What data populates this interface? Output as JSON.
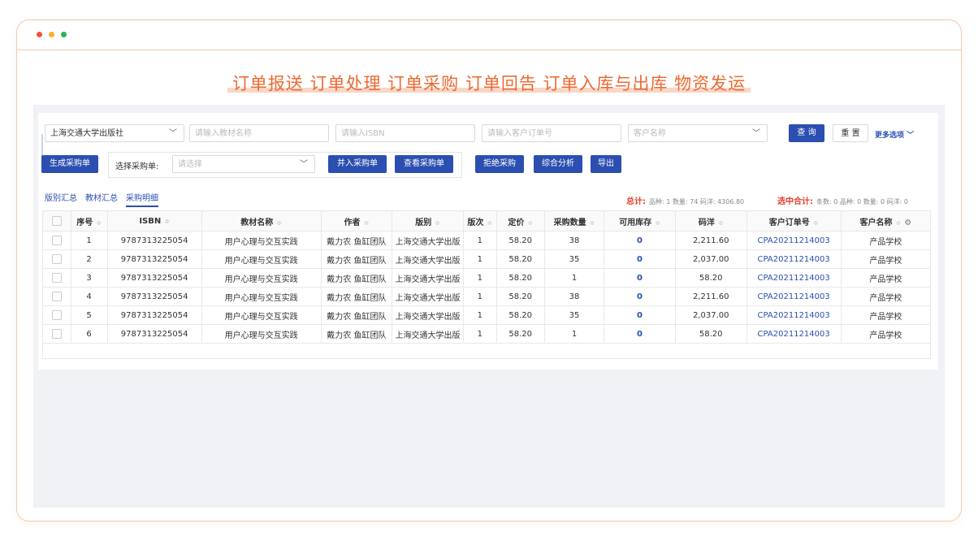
{
  "headline": "订单报送 订单处理 订单采购 订单回告 订单入库与出库 物资发运",
  "filters": {
    "publisher_value": "上海交通大学出版社",
    "textbook_placeholder": "请输入教材名称",
    "isbn_placeholder": "请输入ISBN",
    "order_no_placeholder": "请输入客户订单号",
    "customer_placeholder": "客户名称",
    "query_label": "查 询",
    "reset_label": "重 置",
    "more_label": "更多选项"
  },
  "actions": {
    "generate_label": "生成采购单",
    "select_label": "选择采购单:",
    "select_placeholder": "请选择",
    "merge_label": "并入采购单",
    "view_label": "查看采购单",
    "reject_label": "拒绝采购",
    "analysis_label": "综合分析",
    "export_label": "导出"
  },
  "tabs": [
    "版别汇总",
    "教材汇总",
    "采购明细"
  ],
  "summary": {
    "total_label": "总计:",
    "total_text": "品种: 1   数量: 74   码洋: 4306.80",
    "selected_label": "选中合计:",
    "selected_text": "条数: 0   品种: 0   数量: 0   码洋: 0"
  },
  "table": {
    "headers": [
      "序号",
      "ISBN",
      "教材名称",
      "作者",
      "版别",
      "版次",
      "定价",
      "采购数量",
      "可用库存",
      "码洋",
      "客户订单号",
      "客户名称"
    ],
    "rows": [
      [
        "1",
        "9787313225054",
        "用户心理与交互实践",
        "戴力农 鱼缸团队",
        "上海交通大学出版",
        "1",
        "58.20",
        "38",
        "0",
        "2,211.60",
        "CPA20211214003",
        "产品学校"
      ],
      [
        "2",
        "9787313225054",
        "用户心理与交互实践",
        "戴力农 鱼缸团队",
        "上海交通大学出版",
        "1",
        "58.20",
        "35",
        "0",
        "2,037.00",
        "CPA20211214003",
        "产品学校"
      ],
      [
        "3",
        "9787313225054",
        "用户心理与交互实践",
        "戴力农 鱼缸团队",
        "上海交通大学出版",
        "1",
        "58.20",
        "1",
        "0",
        "58.20",
        "CPA20211214003",
        "产品学校"
      ],
      [
        "4",
        "9787313225054",
        "用户心理与交互实践",
        "戴力农 鱼缸团队",
        "上海交通大学出版",
        "1",
        "58.20",
        "38",
        "0",
        "2,211.60",
        "CPA20211214003",
        "产品学校"
      ],
      [
        "5",
        "9787313225054",
        "用户心理与交互实践",
        "戴力农 鱼缸团队",
        "上海交通大学出版",
        "1",
        "58.20",
        "35",
        "0",
        "2,037.00",
        "CPA20211214003",
        "产品学校"
      ],
      [
        "6",
        "9787313225054",
        "用户心理与交互实践",
        "戴力农 鱼缸团队",
        "上海交通大学出版",
        "1",
        "58.20",
        "1",
        "0",
        "58.20",
        "CPA20211214003",
        "产品学校"
      ]
    ]
  },
  "colors": {
    "accent": "#2b4fb0",
    "headline": "#ec6a33",
    "alert": "#e0402b"
  }
}
